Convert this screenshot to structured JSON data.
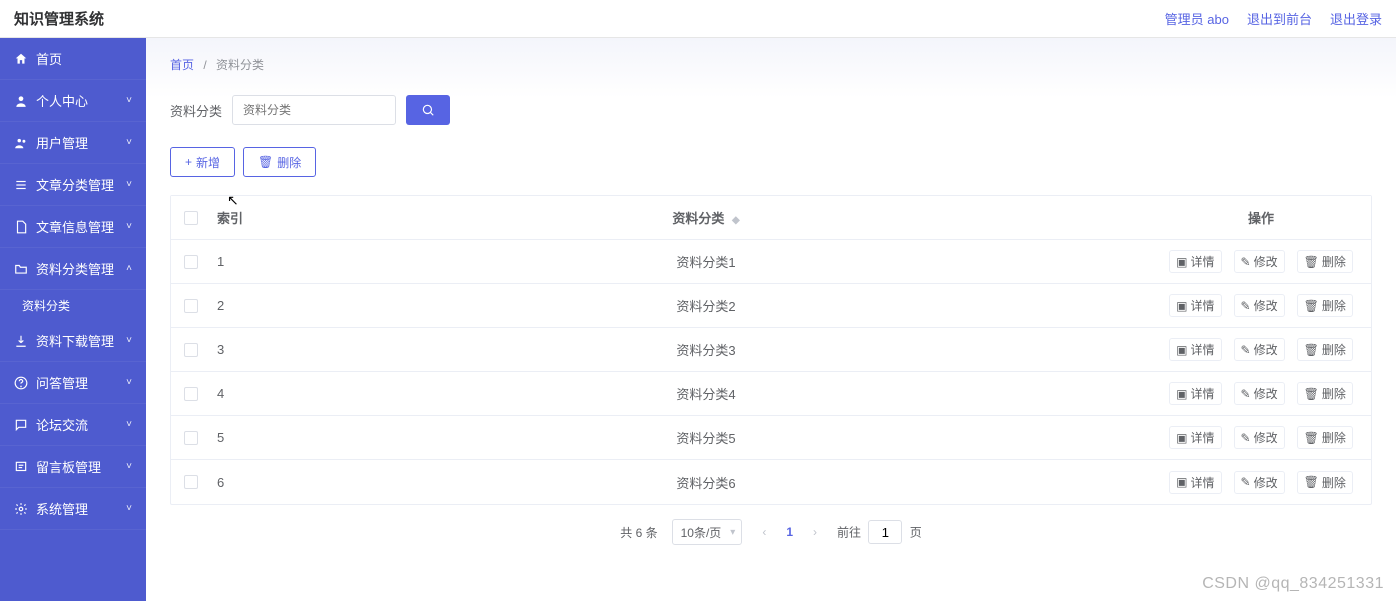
{
  "app_title": "知识管理系统",
  "top_links": {
    "admin": "管理员 abo",
    "to_front": "退出到前台",
    "logout": "退出登录"
  },
  "sidebar": [
    {
      "icon": "home",
      "label": "首页",
      "hasChildren": false
    },
    {
      "icon": "user",
      "label": "个人中心",
      "hasChildren": true,
      "open": false
    },
    {
      "icon": "users",
      "label": "用户管理",
      "hasChildren": true,
      "open": false
    },
    {
      "icon": "list",
      "label": "文章分类管理",
      "hasChildren": true,
      "open": false
    },
    {
      "icon": "file",
      "label": "文章信息管理",
      "hasChildren": true,
      "open": false
    },
    {
      "icon": "folder",
      "label": "资料分类管理",
      "hasChildren": true,
      "open": true,
      "sub": [
        {
          "label": "资料分类"
        }
      ]
    },
    {
      "icon": "download",
      "label": "资料下载管理",
      "hasChildren": true,
      "open": false
    },
    {
      "icon": "question",
      "label": "问答管理",
      "hasChildren": true,
      "open": false
    },
    {
      "icon": "chat",
      "label": "论坛交流",
      "hasChildren": true,
      "open": false
    },
    {
      "icon": "board",
      "label": "留言板管理",
      "hasChildren": true,
      "open": false
    },
    {
      "icon": "gear",
      "label": "系统管理",
      "hasChildren": true,
      "open": false
    }
  ],
  "crumbs": {
    "home": "首页",
    "current": "资料分类"
  },
  "search": {
    "label": "资料分类",
    "placeholder": "资料分类"
  },
  "buttons": {
    "add": "新增",
    "delete": "删除"
  },
  "table": {
    "headers": {
      "index": "索引",
      "category": "资料分类",
      "ops": "操作"
    },
    "rows": [
      {
        "idx": "1",
        "cat": "资料分类1"
      },
      {
        "idx": "2",
        "cat": "资料分类2"
      },
      {
        "idx": "3",
        "cat": "资料分类3"
      },
      {
        "idx": "4",
        "cat": "资料分类4"
      },
      {
        "idx": "5",
        "cat": "资料分类5"
      },
      {
        "idx": "6",
        "cat": "资料分类6"
      }
    ],
    "ops": {
      "detail": "详情",
      "edit": "修改",
      "del": "删除"
    }
  },
  "pager": {
    "total": "共 6 条",
    "perpage": "10条/页",
    "current": "1",
    "goto_prefix": "前往",
    "goto_val": "1",
    "goto_suffix": "页"
  },
  "watermark": "CSDN @qq_834251331"
}
